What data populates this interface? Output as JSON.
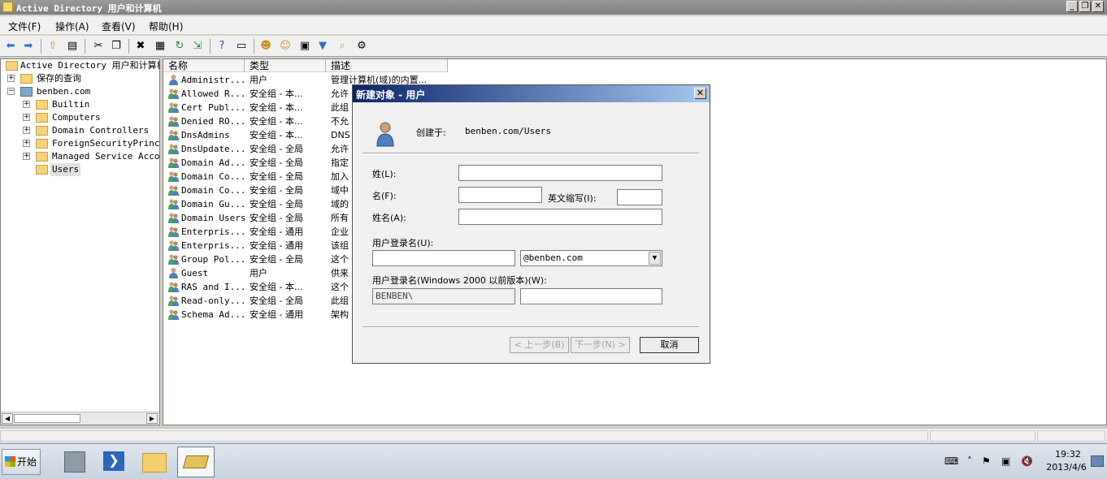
{
  "window": {
    "title": "Active Directory 用户和计算机",
    "min": "_",
    "restore": "❐",
    "close": "✕"
  },
  "menu": [
    "文件(F)",
    "操作(A)",
    "查看(V)",
    "帮助(H)"
  ],
  "toolbar_icons": [
    "back-icon",
    "forward-icon",
    "up-folder-icon",
    "show-hide-tree-icon",
    "cut-icon",
    "copy-icon",
    "delete-icon",
    "properties-icon",
    "refresh-icon",
    "export-list-icon",
    "help-icon",
    "mmc-icon",
    "new-user-icon",
    "new-group-icon",
    "new-ou-icon",
    "filter-icon",
    "find-icon",
    "add-member-icon"
  ],
  "tree": {
    "root": "Active Directory 用户和计算机",
    "saved_queries": "保存的查询",
    "domain": "benben.com",
    "children": [
      "Builtin",
      "Computers",
      "Domain Controllers",
      "ForeignSecurityPrincip",
      "Managed Service Accour",
      "Users"
    ],
    "selected": "Users"
  },
  "list": {
    "columns": [
      "名称",
      "类型",
      "描述"
    ],
    "rows": [
      {
        "name": "Administr...",
        "type": "用户",
        "desc": "管理计算机(域)的内置..."
      },
      {
        "name": "Allowed R...",
        "type": "安全组 - 本...",
        "desc": "允许"
      },
      {
        "name": "Cert Publ...",
        "type": "安全组 - 本...",
        "desc": "此组"
      },
      {
        "name": "Denied RO...",
        "type": "安全组 - 本...",
        "desc": "不允"
      },
      {
        "name": "DnsAdmins",
        "type": "安全组 - 本...",
        "desc": "DNS A"
      },
      {
        "name": "DnsUpdate...",
        "type": "安全组 - 全局",
        "desc": "允许"
      },
      {
        "name": "Domain Ad...",
        "type": "安全组 - 全局",
        "desc": "指定"
      },
      {
        "name": "Domain Co...",
        "type": "安全组 - 全局",
        "desc": "加入"
      },
      {
        "name": "Domain Co...",
        "type": "安全组 - 全局",
        "desc": "域中"
      },
      {
        "name": "Domain Gu...",
        "type": "安全组 - 全局",
        "desc": "域的"
      },
      {
        "name": "Domain Users",
        "type": "安全组 - 全局",
        "desc": "所有"
      },
      {
        "name": "Enterpris...",
        "type": "安全组 - 通用",
        "desc": "企业"
      },
      {
        "name": "Enterpris...",
        "type": "安全组 - 通用",
        "desc": "该组"
      },
      {
        "name": "Group Pol...",
        "type": "安全组 - 全局",
        "desc": "这个"
      },
      {
        "name": "Guest",
        "type": "用户",
        "desc": "供来"
      },
      {
        "name": "RAS and I...",
        "type": "安全组 - 本...",
        "desc": "这个"
      },
      {
        "name": "Read-only...",
        "type": "安全组 - 全局",
        "desc": "此组"
      },
      {
        "name": "Schema Ad...",
        "type": "安全组 - 通用",
        "desc": "架构"
      }
    ]
  },
  "dialog": {
    "title": "新建对象 - 用户",
    "created_in_label": "创建于:",
    "created_in_value": "benben.com/Users",
    "last_name_label": "姓(L):",
    "last_name_value": "",
    "first_name_label": "名(F):",
    "first_name_value": "",
    "initials_label": "英文缩写(I):",
    "initials_value": "",
    "full_name_label": "姓名(A):",
    "full_name_value": "",
    "logon_label": "用户登录名(U):",
    "logon_value": "",
    "domain_suffix": "@benben.com",
    "pre2000_label": "用户登录名(Windows 2000 以前版本)(W):",
    "pre2000_domain": "BENBEN\\",
    "pre2000_value": "",
    "back_button": "< 上一步(B)",
    "next_button": "下一步(N) >",
    "cancel_button": "取消",
    "close": "✕"
  },
  "taskbar": {
    "start": "开始",
    "time": "19:32",
    "date": "2013/4/6"
  }
}
